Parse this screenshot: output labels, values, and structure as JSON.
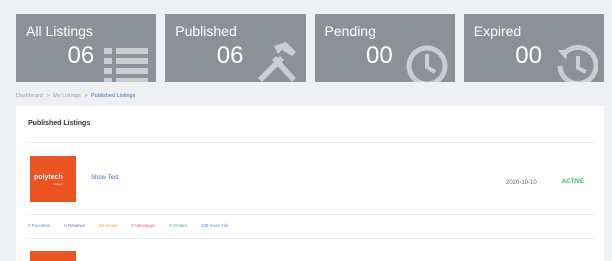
{
  "stats": [
    {
      "label": "All Listings",
      "value": "06",
      "icon": "list-icon"
    },
    {
      "label": "Published",
      "value": "06",
      "icon": "hammer-wrench-icon"
    },
    {
      "label": "Pending",
      "value": "00",
      "icon": "clock-icon"
    },
    {
      "label": "Expired",
      "value": "00",
      "icon": "history-icon"
    }
  ],
  "breadcrumb": {
    "items": [
      "Dashboard",
      "My Listings",
      "Published Listings"
    ],
    "separator": ">"
  },
  "panel": {
    "title": "Published Listings"
  },
  "listing": {
    "thumb_brand": "polytech",
    "thumb_sub": "solutions",
    "name": "Show Test",
    "date": "2020-10-10",
    "status": "ACTIVE",
    "metrics": {
      "favorites": "0 Favorites",
      "reviews": "0 Reviews",
      "views": "36 Views",
      "messages": "0 Messages",
      "orders": "0 Orders",
      "more": "348 more info"
    }
  },
  "colors": {
    "stat_bg": "#8c9197",
    "accent": "#3b6fb6",
    "active": "#2ebd59",
    "thumb": "#e95420"
  }
}
